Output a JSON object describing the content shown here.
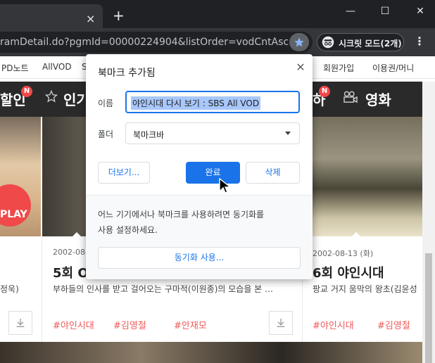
{
  "browser": {
    "tab_close": "×",
    "new_tab": "+",
    "window": {
      "minimize": "—",
      "maximize": "☐",
      "close": "✕"
    },
    "url": "ramDetail.do?pgmId=00000224904&listOrder=vodCntAsc",
    "incognito_label": "시크릿 모드(2개)",
    "menu": "⋮",
    "colors": {
      "accent": "#1a73e8",
      "star": "#8ab4f8"
    }
  },
  "page": {
    "subnav": [
      "PD노트",
      "AllVOD",
      "S",
      "회원가입",
      "이용권/머니"
    ],
    "hero": {
      "left": "할인",
      "mid": "인기",
      "right_partial": "하",
      "right": "영화",
      "badge": "N"
    },
    "play_label": "PLAY",
    "cards": [
      {
        "desc": "정욱)",
        "tags": []
      },
      {
        "date": "2002-08-",
        "title": "5회 O",
        "desc": "부하들의 인사를 받고 걸어오는 구마적(이원종)의 모습을 본 …",
        "tags": [
          "#야인시대",
          "#김영철",
          "#안재모"
        ]
      },
      {
        "date": "2002-08-13 (화)",
        "title": "6회 야인시대",
        "desc": "팡교 거지 움막의 왕초(김윤성",
        "tags": [
          "#야인시대",
          "#김영철"
        ]
      }
    ]
  },
  "bookmark_dialog": {
    "title": "북마크 추가됨",
    "name_label": "이름",
    "name_value": "야인시대 다시 보기 : SBS All VOD",
    "folder_label": "폴더",
    "folder_value": "북마크바",
    "more_button": "더보기...",
    "done_button": "완료",
    "delete_button": "삭제",
    "sync_message_line1": "어느 기기에서나 북마크를 사용하려면 동기화를",
    "sync_message_line2": "사용 설정하세요.",
    "sync_button": "동기화 사용...",
    "close": "✕"
  }
}
